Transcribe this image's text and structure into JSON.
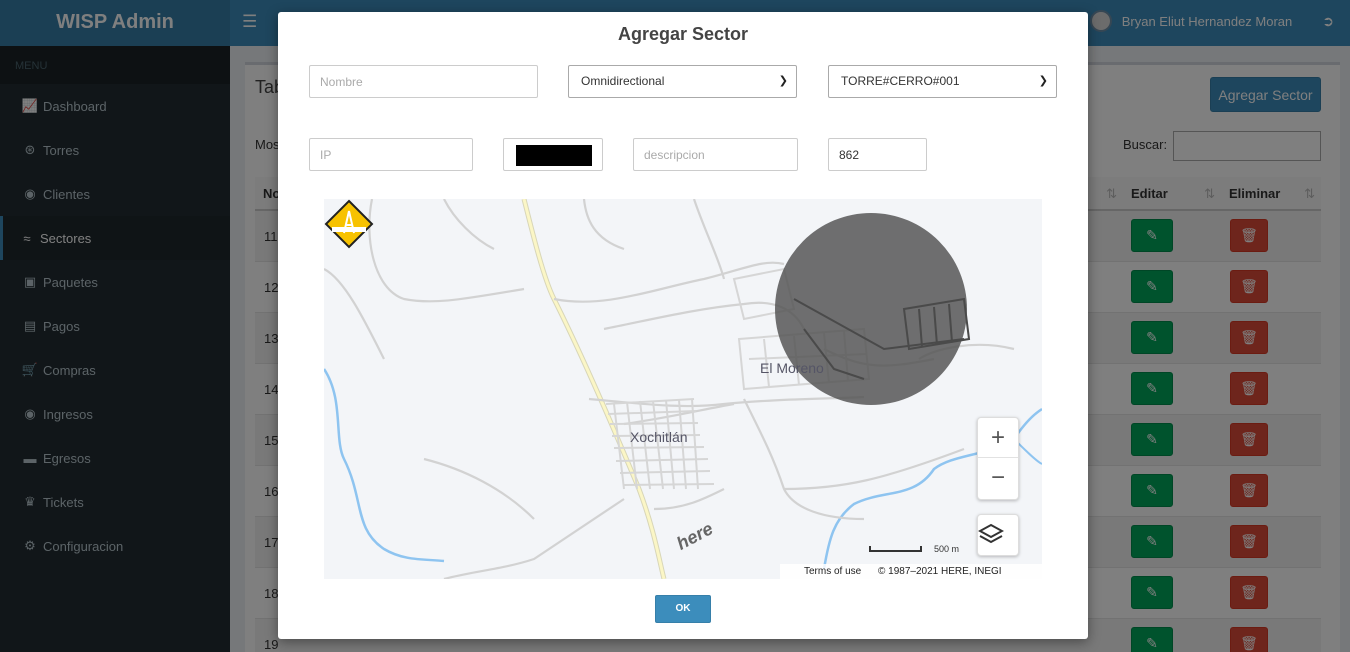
{
  "app": {
    "brand": "WISP Admin",
    "user_name": "Bryan Eliut Hernandez Moran"
  },
  "sidebar": {
    "menu_header": "MENU",
    "items": [
      {
        "label": "Dashboard",
        "icon": "chart-line-icon"
      },
      {
        "label": "Torres",
        "icon": "tower-icon"
      },
      {
        "label": "Clientes",
        "icon": "users-icon"
      },
      {
        "label": "Sectores",
        "icon": "wifi-icon",
        "active": true
      },
      {
        "label": "Paquetes",
        "icon": "boxes-icon"
      },
      {
        "label": "Pagos",
        "icon": "receipt-icon"
      },
      {
        "label": "Compras",
        "icon": "cart-icon"
      },
      {
        "label": "Ingresos",
        "icon": "hand-coin-icon"
      },
      {
        "label": "Egresos",
        "icon": "hand-give-icon"
      },
      {
        "label": "Tickets",
        "icon": "ticket-icon"
      },
      {
        "label": "Configuracion",
        "icon": "gears-icon"
      }
    ]
  },
  "background_page": {
    "title_partial": "Tab",
    "add_button": "Agregar Sector",
    "show_partial": "Mos",
    "search_label": "Buscar:",
    "columns": {
      "first_partial": "No",
      "edit": "Editar",
      "delete": "Eliminar"
    },
    "row_ids": [
      "11",
      "12",
      "13",
      "14",
      "15",
      "16",
      "17",
      "18",
      "19"
    ]
  },
  "modal": {
    "title": "Agregar Sector",
    "fields": {
      "nombre_placeholder": "Nombre",
      "antenna_type": "Omnidirectional",
      "tower": "TORRE#CERRO#001",
      "ip_placeholder": "IP",
      "color": "#000000",
      "descripcion_placeholder": "descripcion",
      "radius_value": "862"
    },
    "map": {
      "labels": {
        "town_1": "El Moreno",
        "town_2": "Xochitlán"
      },
      "zoom_in": "+",
      "zoom_out": "−",
      "scale": "500 m",
      "terms": "Terms of use",
      "copyright": "© 1987–2021 HERE, INEGI",
      "provider_logo": "here"
    },
    "ok_button": "OK"
  },
  "colors": {
    "primary": "#3c8dbc",
    "sidebar_bg": "#222d32",
    "success": "#00a65a",
    "danger": "#dd4b39"
  }
}
